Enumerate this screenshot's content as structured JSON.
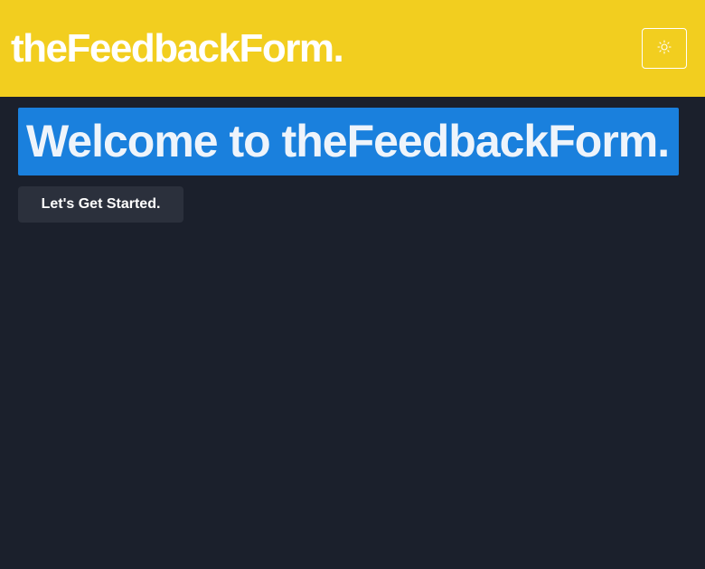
{
  "header": {
    "brand": "theFeedbackForm.",
    "theme_toggle_icon": "sun-icon",
    "background_color": "#f2ce1f"
  },
  "main": {
    "welcome_title": "Welcome to theFeedbackForm.",
    "welcome_background_color": "#1a80dd",
    "start_button_label": "Let's Get Started."
  },
  "page": {
    "background_color": "#1b202c"
  }
}
